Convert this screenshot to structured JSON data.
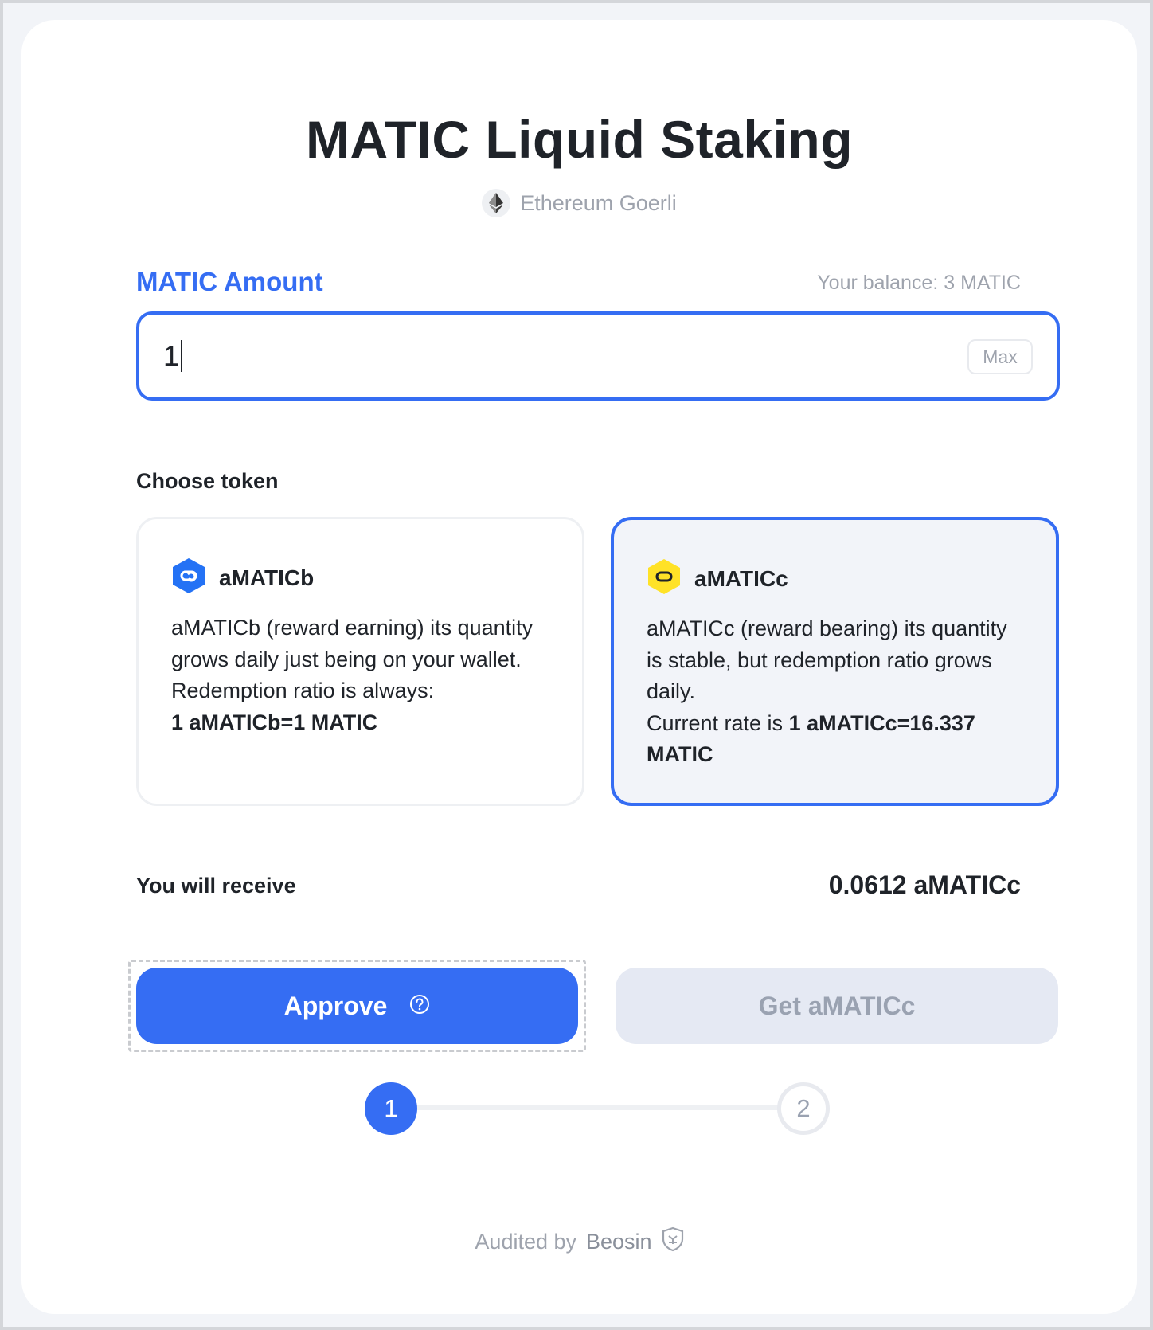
{
  "page": {
    "title": "MATIC Liquid Staking",
    "network": "Ethereum Goerli"
  },
  "amount": {
    "label": "MATIC Amount",
    "balance_text": "Your balance: 3 MATIC",
    "value": "1",
    "max_label": "Max"
  },
  "tokens": {
    "section_label": "Choose token",
    "items": [
      {
        "name": "aMATICb",
        "description": "aMATICb (reward earning) its quantity grows daily just being on your wallet. Redemption ratio is always:",
        "rate": "1 aMATICb=1 MATIC",
        "icon": "polygon-icon-blue",
        "selected": false
      },
      {
        "name": "aMATICc",
        "description": "aMATICc (reward bearing) its quantity is stable, but redemption ratio grows daily.",
        "rate_prefix": "Current rate is ",
        "rate": "1 aMATICc=16.337 MATIC",
        "icon": "polygon-icon-yellow",
        "selected": true
      }
    ]
  },
  "receive": {
    "label": "You will receive",
    "value": "0.0612 aMATICc"
  },
  "actions": {
    "approve_label": "Approve",
    "get_label": "Get aMATICc"
  },
  "steps": {
    "step1": "1",
    "step2": "2"
  },
  "footer": {
    "audited_prefix": "Audited by",
    "auditor": "Beosin"
  },
  "colors": {
    "accent": "#356df3",
    "disabled_bg": "#e5e9f3",
    "muted_text": "#9ea3ad",
    "amaticb_icon": "#2472f5",
    "amaticc_icon": "#ffe227"
  }
}
